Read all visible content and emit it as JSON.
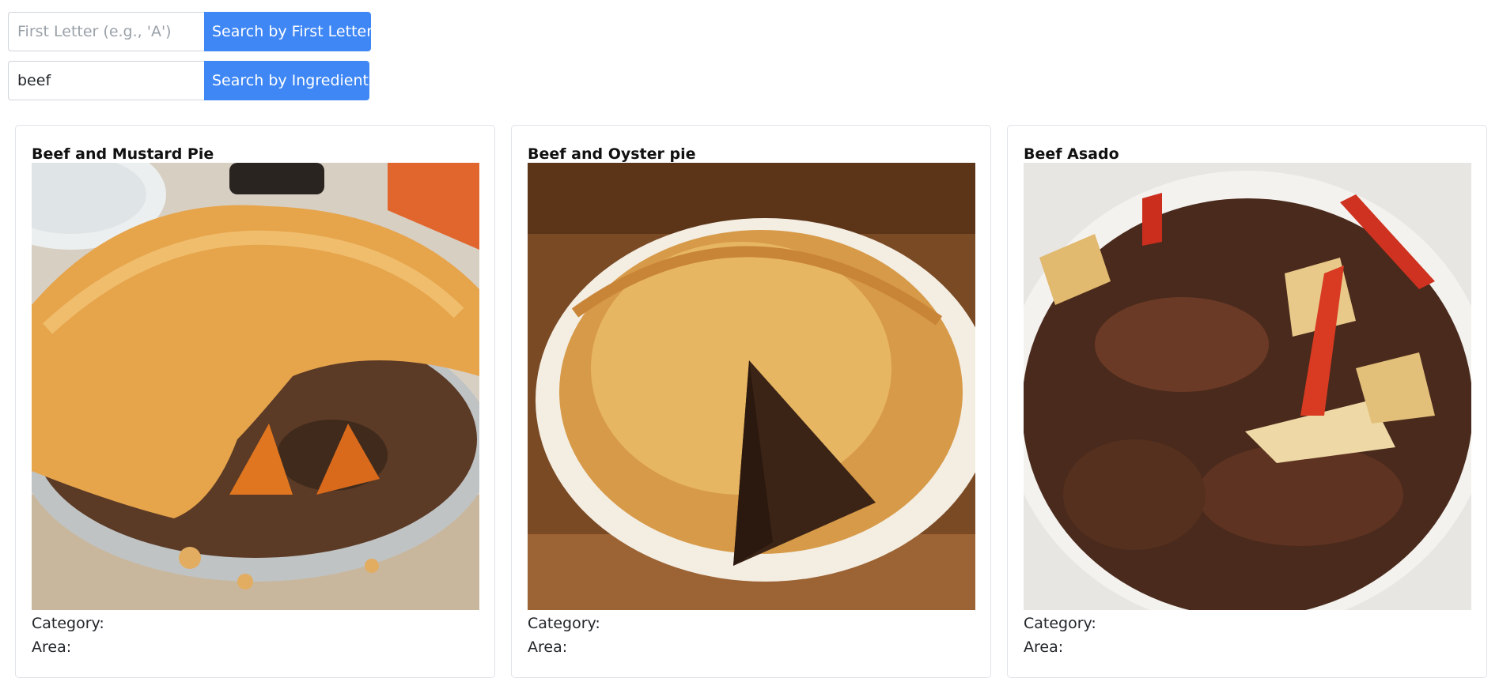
{
  "search": {
    "first_letter": {
      "placeholder": "First Letter (e.g., 'A')",
      "value": "",
      "button_label": "Search by First Letter"
    },
    "ingredient": {
      "placeholder": "",
      "value": "beef",
      "button_label": "Search by Ingredient"
    }
  },
  "meals": [
    {
      "title": "Beef and Mustard Pie",
      "category_label": "Category:",
      "area_label": "Area:"
    },
    {
      "title": "Beef and Oyster pie",
      "category_label": "Category:",
      "area_label": "Area:"
    },
    {
      "title": "Beef Asado",
      "category_label": "Category:",
      "area_label": "Area:"
    }
  ],
  "colors": {
    "accent": "#3f87f5",
    "card_border": "#dfe3e8"
  }
}
